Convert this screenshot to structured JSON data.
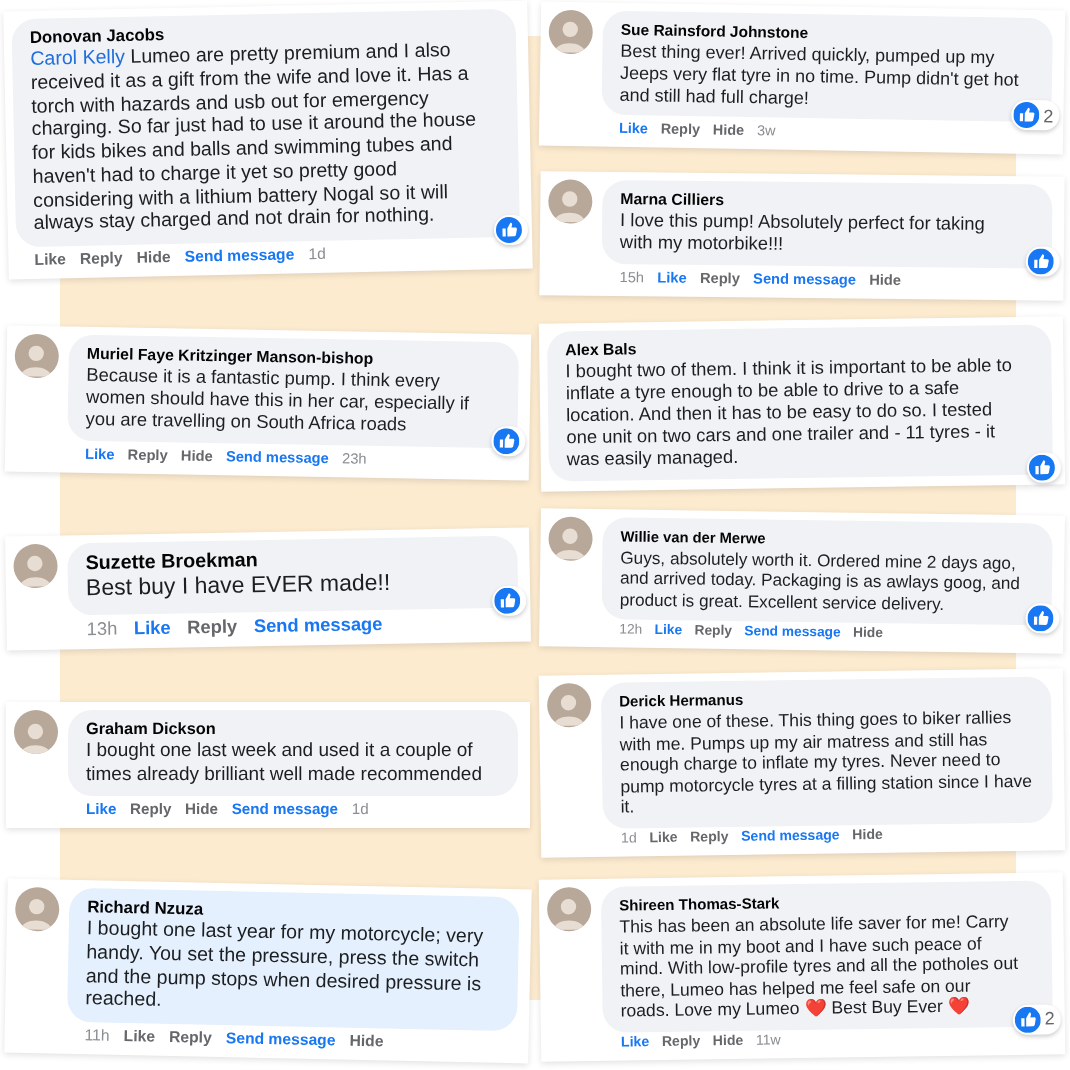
{
  "comments": [
    {
      "name": "Donovan Jacobs",
      "avatar": false,
      "highlighted": false,
      "mention": "Carol Kelly",
      "text": "Lumeo are pretty premium and I also received it as a gift from the wife and love it. Has a torch with hazards and usb out for emergency charging. So far just had to use it around the house for kids bikes and balls and swimming tubes and haven't had to charge it yet so pretty good considering with a lithium battery Nogal so it will always stay charged and not drain for nothing.",
      "actions": [
        {
          "label": "Like",
          "kind": "plain"
        },
        {
          "label": "Reply",
          "kind": "plain"
        },
        {
          "label": "Hide",
          "kind": "plain"
        },
        {
          "label": "Send message",
          "kind": "strong"
        },
        {
          "label": "1d",
          "kind": "time"
        }
      ],
      "reacted": true
    },
    {
      "name": "Sue Rainsford Johnstone",
      "avatar": true,
      "highlighted": false,
      "text": "Best thing ever! Arrived quickly, pumped up my Jeeps very flat tyre in no time. Pump didn't get hot and still had full charge!",
      "actions": [
        {
          "label": "Like",
          "kind": "strong"
        },
        {
          "label": "Reply",
          "kind": "plain"
        },
        {
          "label": "Hide",
          "kind": "plain"
        },
        {
          "label": "3w",
          "kind": "time"
        }
      ],
      "reacted": true,
      "reaction_count": "2"
    },
    {
      "name": "Muriel Faye Kritzinger Manson-bishop",
      "avatar": true,
      "highlighted": false,
      "text": "Because it is a fantastic pump. I think every women should have this in her car, especially if you are travelling on South Africa roads",
      "actions": [
        {
          "label": "Like",
          "kind": "strong"
        },
        {
          "label": "Reply",
          "kind": "plain"
        },
        {
          "label": "Hide",
          "kind": "plain"
        },
        {
          "label": "Send message",
          "kind": "strong"
        },
        {
          "label": "23h",
          "kind": "time"
        }
      ],
      "reacted": true
    },
    {
      "name": "Marna Cilliers",
      "avatar": true,
      "highlighted": false,
      "text": "I love this pump! Absolutely perfect for taking with my motorbike!!!",
      "actions": [
        {
          "label": "15h",
          "kind": "time"
        },
        {
          "label": "Like",
          "kind": "strong"
        },
        {
          "label": "Reply",
          "kind": "plain"
        },
        {
          "label": "Send message",
          "kind": "strong"
        },
        {
          "label": "Hide",
          "kind": "plain"
        }
      ],
      "reacted": true
    },
    {
      "name": "Suzette Broekman",
      "avatar": true,
      "highlighted": false,
      "text": "Best buy I have EVER made!!",
      "actions": [
        {
          "label": "13h",
          "kind": "time"
        },
        {
          "label": "Like",
          "kind": "strong"
        },
        {
          "label": "Reply",
          "kind": "plain"
        },
        {
          "label": "Send message",
          "kind": "strong"
        }
      ],
      "reacted": true
    },
    {
      "name": "Alex Bals",
      "avatar": false,
      "highlighted": false,
      "text": "I bought two of them. I think it is important to be able to inflate a tyre enough to be able to drive to a safe location. And then it has to be easy to do so. I tested one unit on two cars and one trailer and - 11 tyres - it was easily managed.",
      "reacted": true
    },
    {
      "name": "Graham Dickson",
      "avatar": true,
      "highlighted": false,
      "text": "I bought one last week and used it a couple of times already brilliant well made recommended",
      "actions": [
        {
          "label": "Like",
          "kind": "strong"
        },
        {
          "label": "Reply",
          "kind": "plain"
        },
        {
          "label": "Hide",
          "kind": "plain"
        },
        {
          "label": "Send message",
          "kind": "strong"
        },
        {
          "label": "1d",
          "kind": "time"
        }
      ],
      "reacted": false
    },
    {
      "name": "Willie van der Merwe",
      "avatar": true,
      "highlighted": false,
      "text": "Guys, absolutely worth it. Ordered mine 2 days ago, and arrived today. Packaging is as awlays goog, and product is great. Excellent service delivery.",
      "actions": [
        {
          "label": "12h",
          "kind": "time"
        },
        {
          "label": "Like",
          "kind": "strong"
        },
        {
          "label": "Reply",
          "kind": "plain"
        },
        {
          "label": "Send message",
          "kind": "strong"
        },
        {
          "label": "Hide",
          "kind": "plain"
        }
      ],
      "reacted": true
    },
    {
      "name": "Derick Hermanus",
      "avatar": true,
      "highlighted": false,
      "text": "I have one of these. This thing goes to biker rallies with me. Pumps up my air matress and still has enough charge to inflate my tyres. Never need to pump motorcycle tyres at a filling station since I have it.",
      "actions": [
        {
          "label": "1d",
          "kind": "time"
        },
        {
          "label": "Like",
          "kind": "plain"
        },
        {
          "label": "Reply",
          "kind": "plain"
        },
        {
          "label": "Send message",
          "kind": "strong"
        },
        {
          "label": "Hide",
          "kind": "plain"
        }
      ],
      "reacted": false
    },
    {
      "name": "Richard Nzuza",
      "avatar": true,
      "highlighted": true,
      "text": "I bought one last year for my motorcycle; very handy. You set the pressure, press the switch and the pump stops when desired pressure is reached.",
      "actions": [
        {
          "label": "11h",
          "kind": "time"
        },
        {
          "label": "Like",
          "kind": "plain"
        },
        {
          "label": "Reply",
          "kind": "plain"
        },
        {
          "label": "Send message",
          "kind": "strong"
        },
        {
          "label": "Hide",
          "kind": "plain"
        }
      ],
      "reacted": false
    },
    {
      "name": "Shireen Thomas-Stark",
      "avatar": true,
      "highlighted": false,
      "text": "This has been an absolute life saver for me! Carry it with me in my boot and I have such peace of mind. With low-profile tyres and all the potholes out there, Lumeo has helped me feel safe on our roads. Love my Lumeo ❤️ Best Buy Ever ❤️",
      "actions": [
        {
          "label": "Like",
          "kind": "strong"
        },
        {
          "label": "Reply",
          "kind": "plain"
        },
        {
          "label": "Hide",
          "kind": "plain"
        },
        {
          "label": "11w",
          "kind": "time"
        }
      ],
      "reacted": true,
      "reaction_count": "2"
    }
  ]
}
